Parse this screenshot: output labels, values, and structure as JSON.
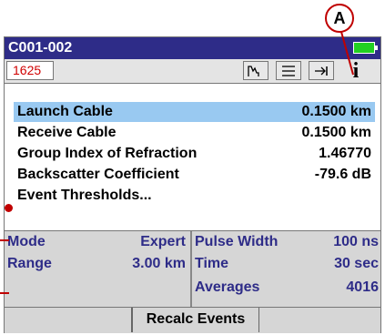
{
  "callout": {
    "label": "A"
  },
  "window": {
    "title": "C001-002"
  },
  "toolbar": {
    "wavelength": "1625",
    "buttons": [
      {
        "icon": "trace-icon"
      },
      {
        "icon": "menu-lines-icon"
      },
      {
        "icon": "arrow-to-bar-icon"
      }
    ],
    "info_icon": "i"
  },
  "parameters": [
    {
      "label": "Launch Cable",
      "value": "0.1500 km",
      "selected": true
    },
    {
      "label": "Receive Cable",
      "value": "0.1500 km",
      "selected": false
    },
    {
      "label": "Group Index of Refraction",
      "value": "1.46770",
      "selected": false
    },
    {
      "label": "Backscatter Coefficient",
      "value": "-79.6 dB",
      "selected": false
    },
    {
      "label": "Event Thresholds...",
      "value": "",
      "selected": false
    }
  ],
  "summary": {
    "left": [
      {
        "key": "Mode",
        "value": "Expert"
      },
      {
        "key": "Range",
        "value": "3.00 km"
      }
    ],
    "right": [
      {
        "key": "Pulse Width",
        "value": "100 ns"
      },
      {
        "key": "Time",
        "value": "30 sec"
      },
      {
        "key": "Averages",
        "value": "4016"
      }
    ]
  },
  "soft_keys": [
    "",
    "Recalc Events",
    "",
    ""
  ],
  "colors": {
    "title_bar": "#2e2c88",
    "battery": "#22d022",
    "selection": "#99c9f1",
    "summary_text": "#2e2c88",
    "callout": "#c00000"
  }
}
